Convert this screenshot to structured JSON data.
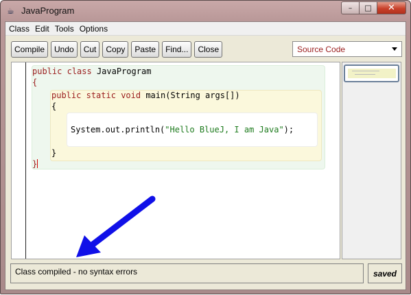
{
  "window": {
    "title": "JavaProgram",
    "controls": {
      "minimize": "–",
      "maximize": "□",
      "close": "✕"
    }
  },
  "menubar": {
    "items": [
      "Class",
      "Edit",
      "Tools",
      "Options"
    ]
  },
  "toolbar": {
    "buttons": [
      "Compile",
      "Undo",
      "Cut",
      "Copy",
      "Paste",
      "Find...",
      "Close"
    ]
  },
  "view_selector": {
    "selected": "Source Code"
  },
  "editor": {
    "lines": [
      {
        "kw1": "public",
        "kw2": "class",
        "rest": "JavaProgram"
      },
      {
        "brace": "{"
      },
      {
        "kw1": "public",
        "kw2": "static",
        "kw3": "void",
        "rest": "main(String args[])"
      },
      {
        "brace": "{"
      },
      {
        "pre": "System.out.println(",
        "str": "\"Hello BlueJ, I am Java\"",
        "post": ");"
      },
      {
        "brace": "}"
      },
      {
        "brace": "}"
      }
    ]
  },
  "status": {
    "message": "Class compiled - no syntax errors",
    "state": "saved"
  },
  "colors": {
    "annotation_arrow": "#1010e8",
    "keyword": "#9a1c1c",
    "string": "#1c7a1c"
  },
  "icons": {
    "app": "bluej-app-icon",
    "annotation": "arrow-pointing-to-status"
  }
}
